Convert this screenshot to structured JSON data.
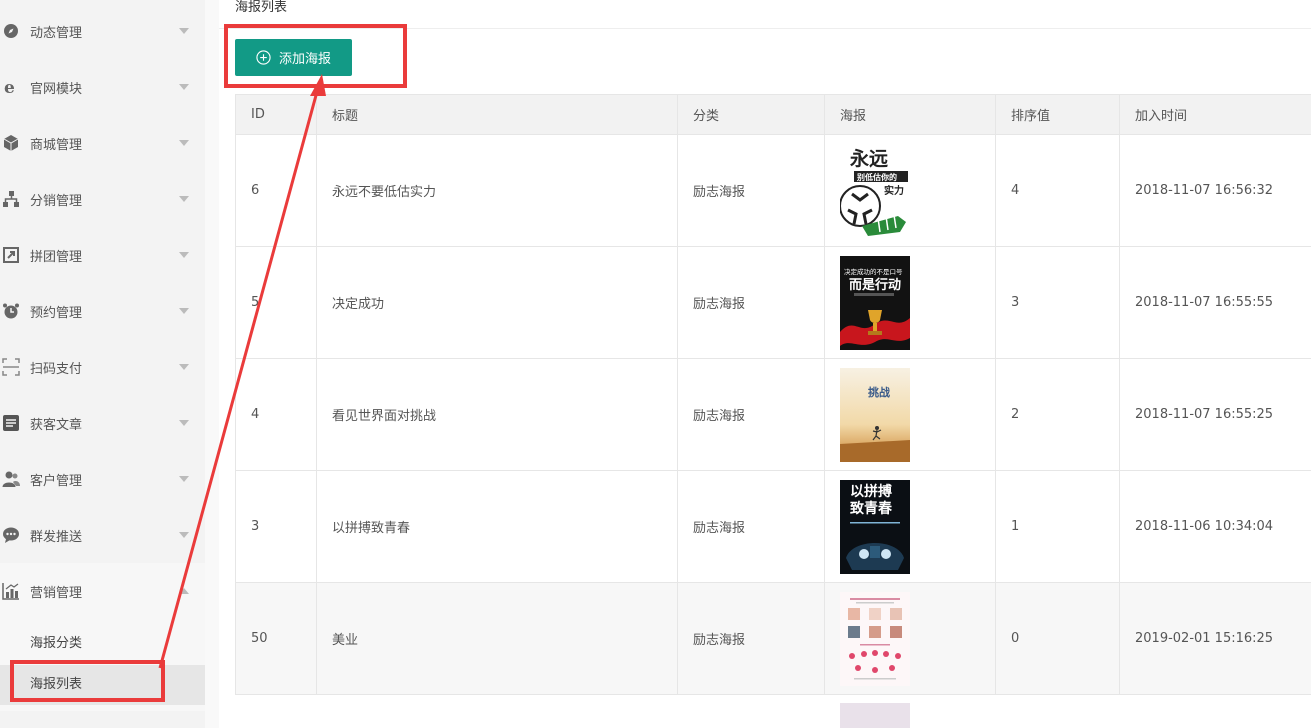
{
  "sidebar": {
    "items": [
      {
        "label": "动态管理",
        "icon": "compass-icon"
      },
      {
        "label": "官网模块",
        "icon": "ie-icon"
      },
      {
        "label": "商城管理",
        "icon": "cube-icon"
      },
      {
        "label": "分销管理",
        "icon": "sitemap-icon"
      },
      {
        "label": "拼团管理",
        "icon": "share-square-icon"
      },
      {
        "label": "预约管理",
        "icon": "alarm-clock-icon"
      },
      {
        "label": "扫码支付",
        "icon": "scan-icon"
      },
      {
        "label": "获客文章",
        "icon": "article-icon"
      },
      {
        "label": "客户管理",
        "icon": "users-icon"
      },
      {
        "label": "群发推送",
        "icon": "chat-icon"
      },
      {
        "label": "营销管理",
        "icon": "chart-icon"
      }
    ],
    "sub_items": [
      {
        "label": "海报分类"
      },
      {
        "label": "海报列表"
      }
    ]
  },
  "breadcrumb": "海报列表",
  "add_button_label": "添加海报",
  "table": {
    "columns": [
      "ID",
      "标题",
      "分类",
      "海报",
      "排序值",
      "加入时间"
    ],
    "rows": [
      {
        "id": "6",
        "title": "永远不要低估实力",
        "category": "励志海报",
        "sort": "4",
        "time": "2018-11-07 16:56:32",
        "poster": {
          "text1": "永远",
          "text2": "别低估你的",
          "text3": "实力"
        }
      },
      {
        "id": "5",
        "title": "决定成功",
        "category": "励志海报",
        "sort": "3",
        "time": "2018-11-07 16:55:55",
        "poster": {
          "text1": "决定成功的不是口号",
          "text2": "而是行动"
        }
      },
      {
        "id": "4",
        "title": "看见世界面对挑战",
        "category": "励志海报",
        "sort": "2",
        "time": "2018-11-07 16:55:25",
        "poster": {
          "text1": "挑战"
        }
      },
      {
        "id": "3",
        "title": "以拼搏致青春",
        "category": "励志海报",
        "sort": "1",
        "time": "2018-11-06 10:34:04",
        "poster": {
          "text1": "以拼搏",
          "text2": "致青春"
        }
      },
      {
        "id": "50",
        "title": "美业",
        "category": "励志海报",
        "sort": "0",
        "time": "2019-02-01 15:16:25",
        "poster": {}
      }
    ]
  },
  "colors": {
    "accent": "#129a86",
    "highlight": "#ea3b3b",
    "sidebar_bg": "#f3f3f3"
  }
}
